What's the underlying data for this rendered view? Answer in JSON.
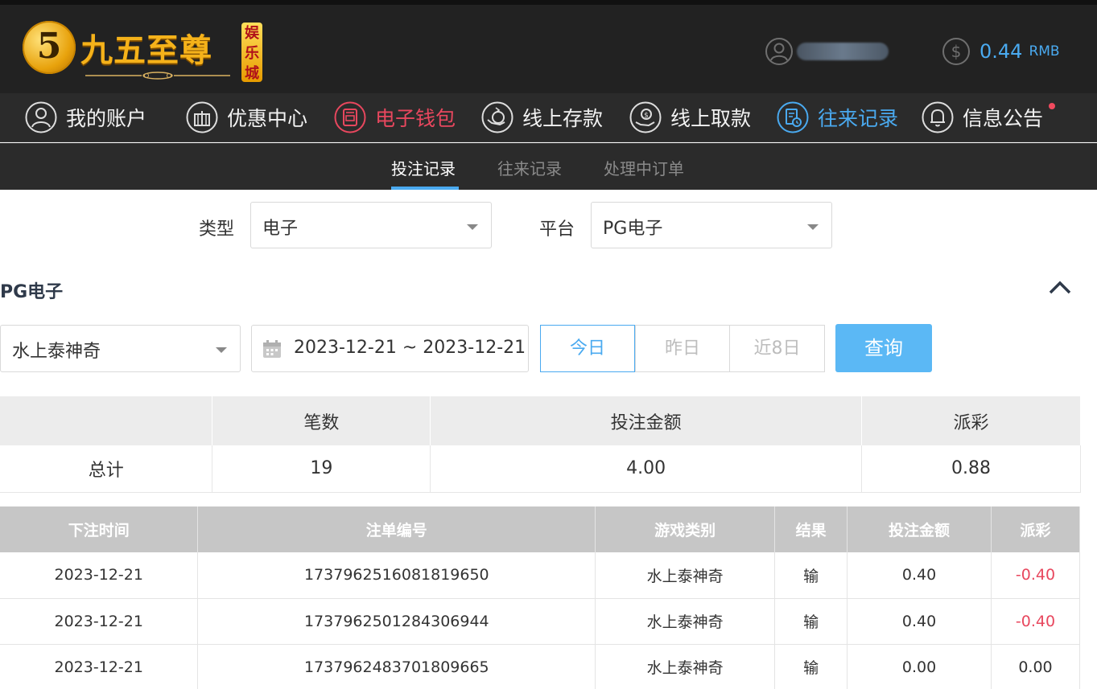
{
  "logo": {
    "mark": "5",
    "name": "九五至尊",
    "badge": [
      "娱",
      "乐",
      "城"
    ]
  },
  "account": {
    "balance": "0.44",
    "currency": "RMB"
  },
  "nav": [
    {
      "label": "我的账户",
      "icon": "user-icon"
    },
    {
      "label": "优惠中心",
      "icon": "gift-icon"
    },
    {
      "label": "电子钱包",
      "icon": "wallet-icon"
    },
    {
      "label": "线上存款",
      "icon": "deposit-icon"
    },
    {
      "label": "线上取款",
      "icon": "withdraw-icon"
    },
    {
      "label": "往来记录",
      "icon": "record-icon"
    },
    {
      "label": "信息公告",
      "icon": "bell-icon"
    }
  ],
  "subtabs": [
    "投注记录",
    "往来记录",
    "处理中订单"
  ],
  "filters": {
    "type_label": "类型",
    "type_value": "电子",
    "platform_label": "平台",
    "platform_value": "PG电子"
  },
  "section": {
    "title": "PG电子"
  },
  "search": {
    "game": "水上泰神奇",
    "date_range": "2023-12-21 ~ 2023-12-21",
    "quick": [
      "今日",
      "昨日",
      "近8日"
    ],
    "query_label": "查询"
  },
  "summary": {
    "headers": [
      "",
      "笔数",
      "投注金额",
      "派彩"
    ],
    "row": [
      "总计",
      "19",
      "4.00",
      "0.88"
    ]
  },
  "records": {
    "headers": [
      "下注时间",
      "注单编号",
      "游戏类别",
      "结果",
      "投注金额",
      "派彩"
    ],
    "rows": [
      [
        "2023-12-21",
        "1737962516081819650",
        "水上泰神奇",
        "输",
        "0.40",
        "-0.40"
      ],
      [
        "2023-12-21",
        "1737962501284306944",
        "水上泰神奇",
        "输",
        "0.40",
        "-0.40"
      ],
      [
        "2023-12-21",
        "1737962483701809665",
        "水上泰神奇",
        "输",
        "0.00",
        "0.00"
      ]
    ]
  },
  "colors": {
    "accent": "#4aaaf0",
    "active_red": "#e8475e",
    "header_bg": "#222222"
  }
}
